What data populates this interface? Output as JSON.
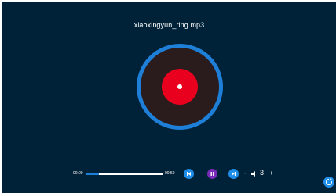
{
  "player": {
    "track_title": "xiaoxingyun_ring.mp3",
    "current_time": "00:00",
    "duration": "00:59",
    "progress_fraction": 0.17,
    "volume_minus": "-",
    "volume_level": "3",
    "volume_plus": "+",
    "is_playing": true
  },
  "icons": {
    "prev": "skip-previous-icon",
    "pause": "pause-icon",
    "next": "skip-next-icon",
    "volume": "speaker-icon",
    "corner": "refresh-icon"
  },
  "colors": {
    "background": "#002238",
    "accent_blue": "#1e7fd8",
    "pause_purple": "#7a2ab8",
    "disc_label_red": "#e8001e",
    "disc_body": "#2a1c1c"
  }
}
